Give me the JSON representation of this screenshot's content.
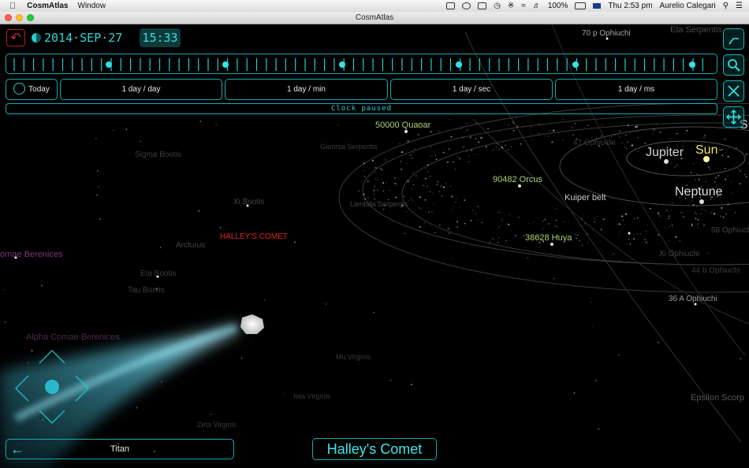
{
  "menubar": {
    "app_name": "CosmAtlas",
    "menu_window": "Window",
    "battery": "100%",
    "clock": "Thu 2:53 pm",
    "user": "Aurelio Calegari"
  },
  "window": {
    "title": "CosmAtlas"
  },
  "toolbar": {
    "date": "2014·SEP·27",
    "time": "15:33",
    "today_label": "Today",
    "speeds": [
      "1 day / day",
      "1 day / min",
      "1 day / sec",
      "1 day / ms"
    ],
    "clock_status": "Clock paused"
  },
  "labels": {
    "p70_ophiuchi": "70 p Ophiuchi",
    "eta_serpentis": "Eta Serpentis",
    "quaoar": "50000 Quaoar",
    "orcus": "90482 Orcus",
    "huya": "38628 Huya",
    "kuiper": "Kuiper belt",
    "jupiter": "Jupiter",
    "sun": "Sun",
    "neptune": "Neptune",
    "saturn_partial": "S",
    "gamma_serpentis": "Gamma Serpentis",
    "lambda_serpentis": "Lambda Serpentis",
    "sigma_bootis": "Sigma Bootis",
    "xi_bootis": "Xi Bootis",
    "halley_label": "HALLEY'S COMET",
    "arcturus": "Arcturus",
    "coma_berenices": "omae Berenices",
    "eta_bootis": "Eta Bootis",
    "tau_bootis": "Tau Bootis",
    "alpha_comae": "Alpha Comae Berenices",
    "ophiuchi_47": "47 Ophiuchi",
    "ophiuchi_58": "58 Ophiuchi",
    "xi_ophiuchi": "Xi Ophiuchi",
    "ophiuchi_44": "44 b Ophiuchi",
    "ophiuchi_36": "36 A Ophiuchi",
    "epsilon_scorpii": "Epsilon Scorp",
    "mu_virginis": "Mu Virginis",
    "iota_virginis": "Iota Virginis",
    "zeta_virginis": "Zeta Virginis"
  },
  "bottom": {
    "back_target": "Titan",
    "selected_object": "Halley's Comet"
  },
  "colors": {
    "accent": "#1fd0d0",
    "halley_label": "#e0241c",
    "planet_label": "#cfd3d6",
    "sun_label": "#f1e36b",
    "minor_body_label": "#b3cf7a"
  }
}
